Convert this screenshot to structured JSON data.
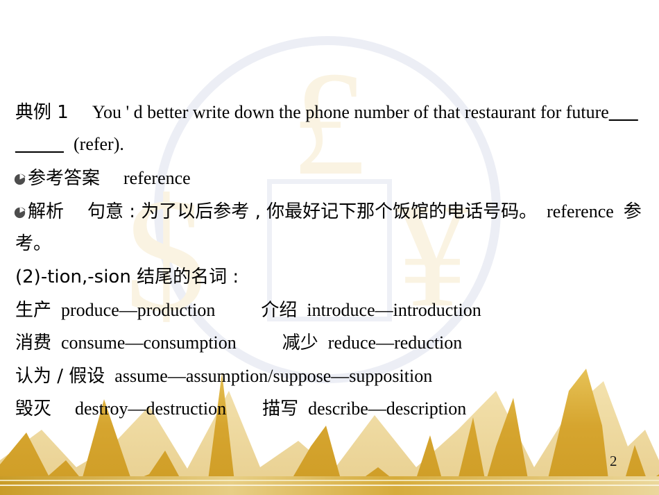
{
  "slide": {
    "page_number": "2",
    "background_color": "#ffffff",
    "accent_gold": "#D2A02C",
    "watermark": {
      "ring_color": "#eceef5",
      "square_color": "#eef0f6",
      "symbol_color": "#faf3e2",
      "symbols": [
        "£",
        "$",
        "¥"
      ],
      "names": [
        "circle-ring-watermark",
        "square-outline-watermark",
        "pound-symbol-watermark",
        "dollar-symbol-watermark",
        "yen-symbol-watermark"
      ]
    },
    "decoration": {
      "name": "gold-mountain-silhouette",
      "color_top": "#E4BE52",
      "color_mid": "#D2A02C",
      "color_dark": "#C89522",
      "band_color": "#D9AD3B"
    }
  },
  "content": {
    "example": {
      "label": "典例 1",
      "sentence_part1": "You ' d better write down the phone number of that restaurant for future",
      "blank1": "___",
      "blank2": "_____",
      "sentence_part2": "(refer)."
    },
    "answer": {
      "bullet": "crescent-bullet-icon",
      "label": "参考答案",
      "value": "reference"
    },
    "analysis": {
      "bullet": "crescent-bullet-icon",
      "label": "解析",
      "text_line1": "句意 : 为了以后参考 , 你最好记下那个饭馆的电话号码。",
      "text_line1_en": "reference",
      "text_line1_cn_tail": "参",
      "text_line2": "考。"
    },
    "section_heading": "(2)-tion,-sion 结尾的名词 :",
    "word_rows": [
      {
        "left_cn": "生产",
        "left_en": "produce—production",
        "right_cn": "介绍",
        "right_en": "introduce—introduction"
      },
      {
        "left_cn": "消费",
        "left_en": "consume—consumption",
        "right_cn": "减少",
        "right_en": "reduce—reduction"
      },
      {
        "left_cn": "认为 / 假设",
        "left_en": "assume—assumption/suppose—supposition",
        "right_cn": "",
        "right_en": ""
      },
      {
        "left_cn": "毁灭",
        "left_en": "destroy—destruction",
        "right_cn": "描写",
        "right_en": "describe—description"
      }
    ]
  }
}
